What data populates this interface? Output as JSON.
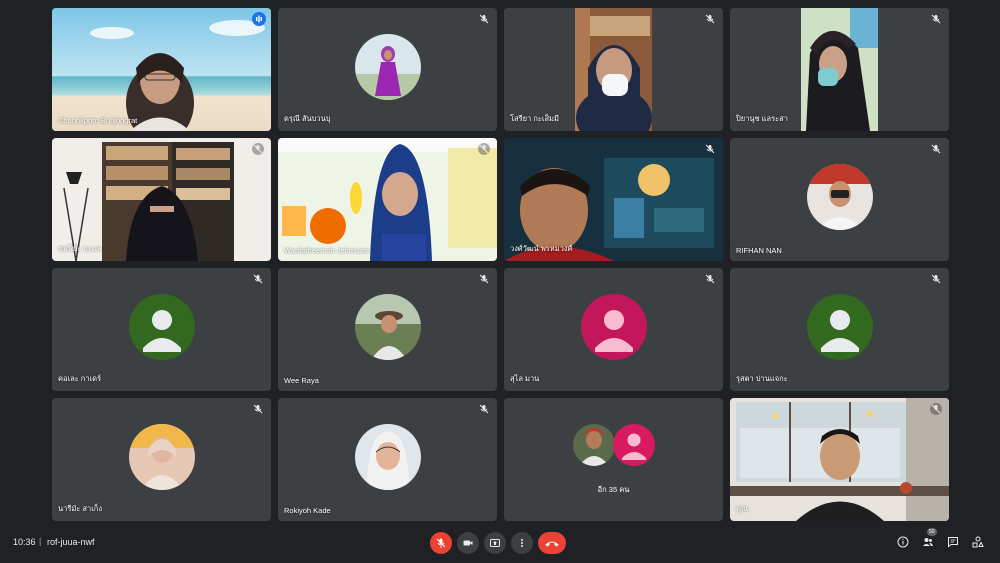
{
  "participants": [
    {
      "name": "Chanokporn Bunjongrat",
      "type": "video",
      "speaking": true
    },
    {
      "name": "ดรุณี สันบวนบุ",
      "type": "photo"
    },
    {
      "name": "โสรียา กะเส็มมี",
      "type": "video"
    },
    {
      "name": "ปิยานุช แลระสา",
      "type": "video"
    },
    {
      "name": "ซอฟีย๊ะ ยะแล",
      "type": "video"
    },
    {
      "name": "Wanfatheemoh Jehmuzor",
      "type": "video"
    },
    {
      "name": "วงศ์วัฒน์ พรหมวงศ์",
      "type": "video"
    },
    {
      "name": "RIFHAN NAN",
      "type": "photo"
    },
    {
      "name": "คอเละ กาเดร์",
      "type": "initial",
      "color": "#33691e"
    },
    {
      "name": "Wee Raya",
      "type": "photo"
    },
    {
      "name": "สุไล มาน",
      "type": "initial",
      "color": "#c2185b"
    },
    {
      "name": "รุสตา ปานแจกะ",
      "type": "initial",
      "color": "#33691e"
    },
    {
      "name": "นารีมัะ สาเก็ง",
      "type": "photo"
    },
    {
      "name": "Rokiyoh Kade",
      "type": "photo"
    },
    {
      "name": "",
      "type": "more",
      "label": "อีก 35 คน"
    },
    {
      "name": "คุณ",
      "type": "video"
    }
  ],
  "bottom_bar": {
    "time": "10:36",
    "separator": "|",
    "meeting_code": "rof-juua-nwf",
    "people_count": "50"
  },
  "colors": {
    "background": "#202124",
    "tile": "#3c4043",
    "danger": "#ea4335",
    "accent": "#1a73e8"
  }
}
